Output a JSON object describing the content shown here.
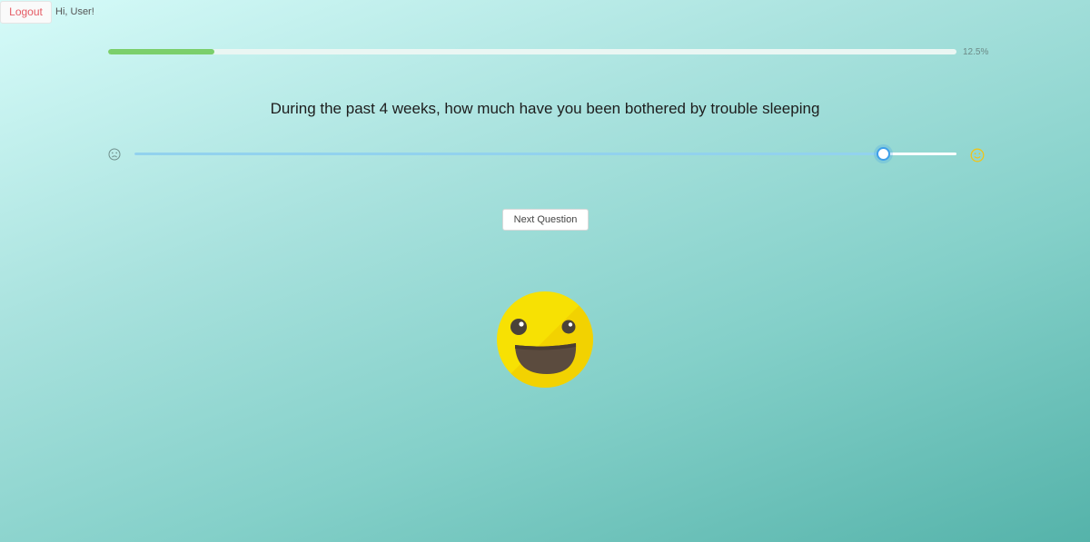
{
  "header": {
    "logout_label": "Logout",
    "greeting": "Hi, User!"
  },
  "progress": {
    "value": 0.125,
    "label": "12.5%"
  },
  "question": {
    "text": "During the past 4 weeks, how much have you been bothered by trouble sleeping"
  },
  "slider": {
    "value": 0.91,
    "left_icon": "sad-face-icon",
    "right_icon": "happy-face-icon"
  },
  "actions": {
    "next_label": "Next Question"
  },
  "mood_emoji": {
    "icon": "laughing-face-icon"
  },
  "colors": {
    "progress_fill": "#7bcf6b",
    "slider_fill": "#92d2ee",
    "slider_handle": "#3f9fe9",
    "logout_text": "#e55b64",
    "emoji_yellow": "#f7e103"
  }
}
